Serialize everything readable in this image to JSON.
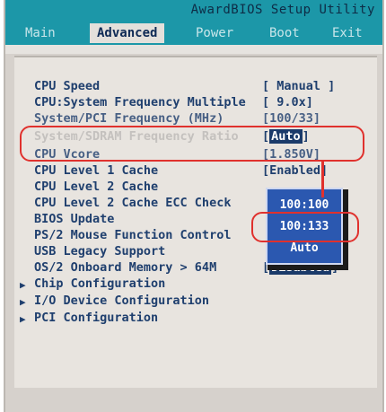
{
  "title": "AwardBIOS Setup Utility",
  "tabs": [
    {
      "label": "Main"
    },
    {
      "label": "Advanced"
    },
    {
      "label": "Power"
    },
    {
      "label": "Boot"
    },
    {
      "label": "Exit"
    }
  ],
  "settings": [
    {
      "label": "CPU Speed",
      "value": "[  Manual  ]"
    },
    {
      "label": "CPU:System Frequency Multiple",
      "value": "[ 9.0x]"
    },
    {
      "label": "System/PCI Frequency (MHz)",
      "value": "[100/33]"
    },
    {
      "label": "System/SDRAM Frequency Ratio",
      "value_open": "[",
      "value_selected": "Auto",
      "value_close": "]"
    },
    {
      "label": "CPU Vcore",
      "value": "[1.850V]"
    },
    {
      "label": "CPU Level 1 Cache",
      "value": "[Enabled]"
    },
    {
      "label": "CPU Level 2 Cache",
      "value": ""
    },
    {
      "label": "CPU Level 2 Cache ECC Check",
      "value": ""
    },
    {
      "label": "BIOS Update",
      "value": ""
    },
    {
      "label": "PS/2 Mouse Function Control",
      "value": ""
    },
    {
      "label": "USB Legacy Support",
      "value": ""
    },
    {
      "label": "OS/2 Onboard Memory > 64M",
      "value_open": "[",
      "value_selected": "Disabled",
      "value_close": "]"
    }
  ],
  "submenus": [
    {
      "label": "Chip Configuration"
    },
    {
      "label": "I/O Device Configuration"
    },
    {
      "label": "PCI Configuration"
    }
  ],
  "popup": {
    "options": [
      "100:100",
      "100:133",
      "Auto"
    ]
  },
  "colors": {
    "title_bar": "#1c97a8",
    "text": "#1f3f6e",
    "popup": "#2b58b0",
    "callout": "#e0312d"
  },
  "icons": {
    "submenu": "triangle-right-icon"
  }
}
